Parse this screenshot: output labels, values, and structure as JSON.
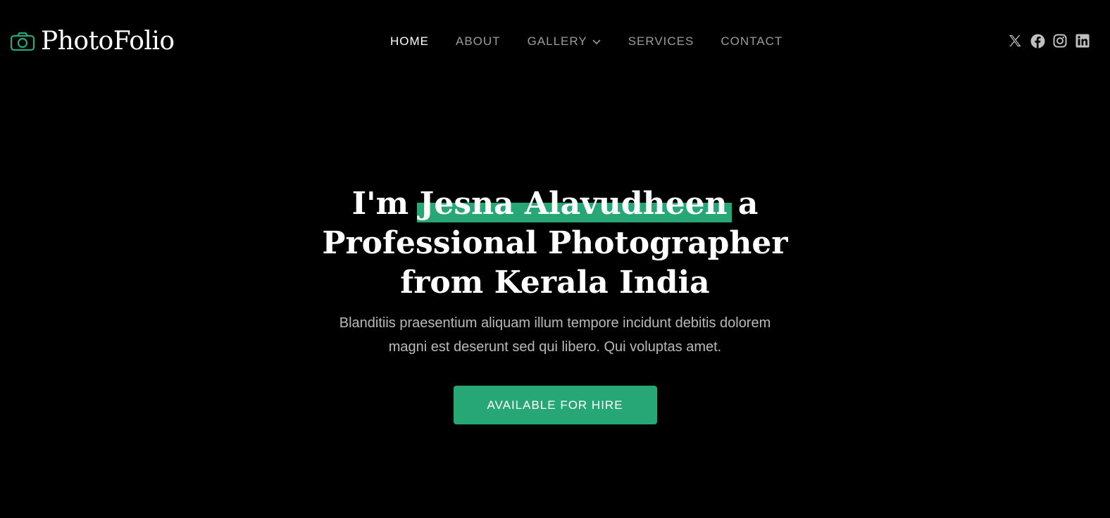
{
  "brand": {
    "name": "PhotoFolio",
    "icon": "camera-icon",
    "accent_color": "#27a776"
  },
  "nav": {
    "items": [
      {
        "label": "HOME",
        "active": true
      },
      {
        "label": "ABOUT",
        "active": false
      },
      {
        "label": "GALLERY",
        "active": false,
        "icon": "chevron-down-icon"
      },
      {
        "label": "SERVICES",
        "active": false
      },
      {
        "label": "CONTACT",
        "active": false
      }
    ]
  },
  "social": {
    "icons": [
      "x-twitter-icon",
      "facebook-icon",
      "instagram-icon",
      "linkedin-icon"
    ]
  },
  "hero": {
    "title_prefix": "I'm",
    "title_name": "Jesna Alavudheen",
    "title_suffix": "a Professional Photographer from Kerala India",
    "subtitle": "Blanditiis praesentium aliquam illum tempore incidunt debitis dolorem magni est deserunt sed qui libero. Qui voluptas amet.",
    "cta_label": "AVAILABLE FOR HIRE"
  },
  "colors": {
    "background": "#000000",
    "text": "#ffffff",
    "muted_text": "#b8b8b8"
  }
}
